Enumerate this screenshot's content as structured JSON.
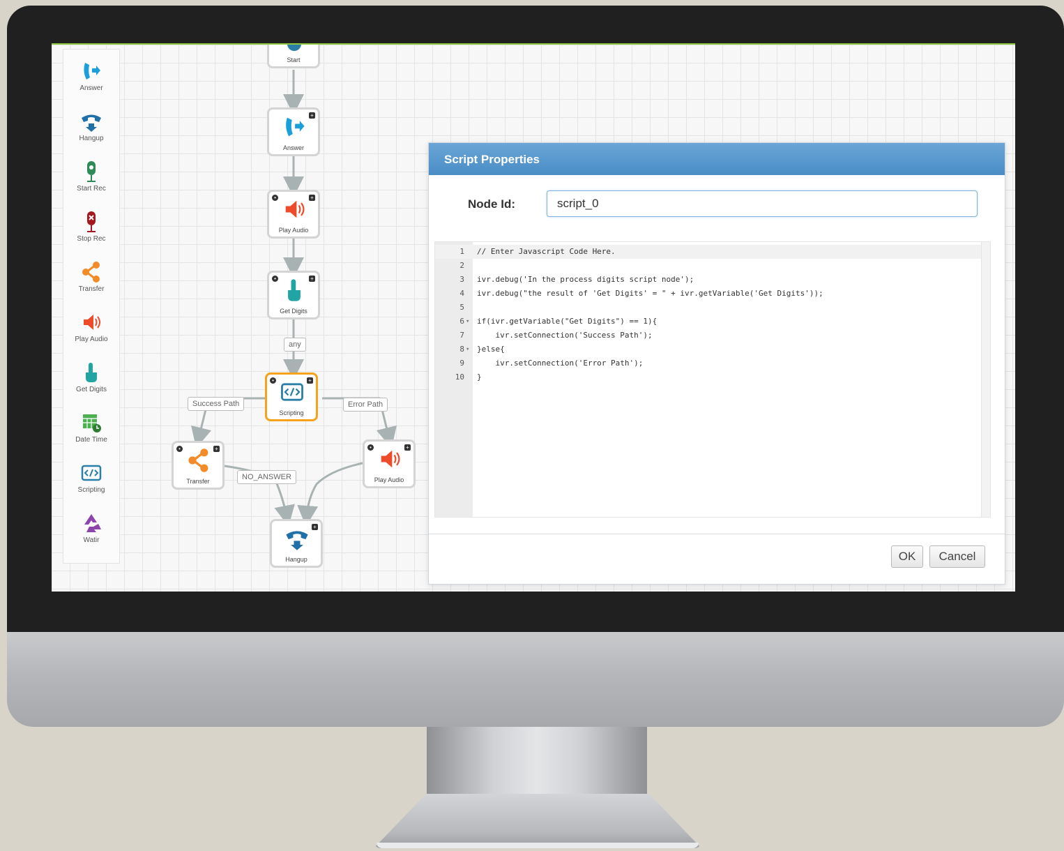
{
  "palette": {
    "items": [
      {
        "label": "Answer",
        "icon": "phone-answer-icon",
        "color": "#1a9fd9"
      },
      {
        "label": "Hangup",
        "icon": "phone-hangup-icon",
        "color": "#1f6fa8"
      },
      {
        "label": "Start Rec",
        "icon": "mic-start-icon",
        "color": "#2e8b57"
      },
      {
        "label": "Stop Rec",
        "icon": "mic-stop-icon",
        "color": "#a3191f"
      },
      {
        "label": "Transfer",
        "icon": "share-icon",
        "color": "#f28c28"
      },
      {
        "label": "Play Audio",
        "icon": "speaker-icon",
        "color": "#ee4b2b"
      },
      {
        "label": "Get Digits",
        "icon": "touch-icon",
        "color": "#20a4a4"
      },
      {
        "label": "Date Time",
        "icon": "calendar-clock-icon",
        "color": "#4caf50"
      },
      {
        "label": "Scripting",
        "icon": "code-icon",
        "color": "#2a7fa8"
      },
      {
        "label": "Watir",
        "icon": "recycle-icon",
        "color": "#8e44ad"
      }
    ]
  },
  "flow": {
    "nodes": {
      "start": "Start",
      "answer": "Answer",
      "play_audio_1": "Play Audio",
      "get_digits": "Get Digits",
      "scripting": "Scripting",
      "transfer": "Transfer",
      "play_audio_2": "Play Audio",
      "hangup": "Hangup"
    },
    "edge_labels": {
      "any": "any",
      "success": "Success Path",
      "error": "Error Path",
      "no_answer": "NO_ANSWER"
    }
  },
  "dialog": {
    "title": "Script Properties",
    "node_id_label": "Node Id:",
    "node_id_value": "script_0",
    "ok_label": "OK",
    "cancel_label": "Cancel",
    "code_lines": [
      {
        "n": "1",
        "fold": "",
        "text": "// Enter Javascript Code Here."
      },
      {
        "n": "2",
        "fold": "",
        "text": ""
      },
      {
        "n": "3",
        "fold": "",
        "text": "ivr.debug('In the process digits script node');"
      },
      {
        "n": "4",
        "fold": "",
        "text": "ivr.debug(\"the result of 'Get Digits' = \" + ivr.getVariable('Get Digits'));"
      },
      {
        "n": "5",
        "fold": "",
        "text": ""
      },
      {
        "n": "6",
        "fold": "▾",
        "text": "if(ivr.getVariable(\"Get Digits\") == 1){"
      },
      {
        "n": "7",
        "fold": "",
        "text": "    ivr.setConnection('Success Path');"
      },
      {
        "n": "8",
        "fold": "▾",
        "text": "}else{"
      },
      {
        "n": "9",
        "fold": "",
        "text": "    ivr.setConnection('Error Path');"
      },
      {
        "n": "10",
        "fold": "",
        "text": "}"
      }
    ]
  },
  "colors": {
    "accent_border": "#8dc63f",
    "dialog_header": "#4a8cc6",
    "selected_node": "#f7a21b"
  }
}
